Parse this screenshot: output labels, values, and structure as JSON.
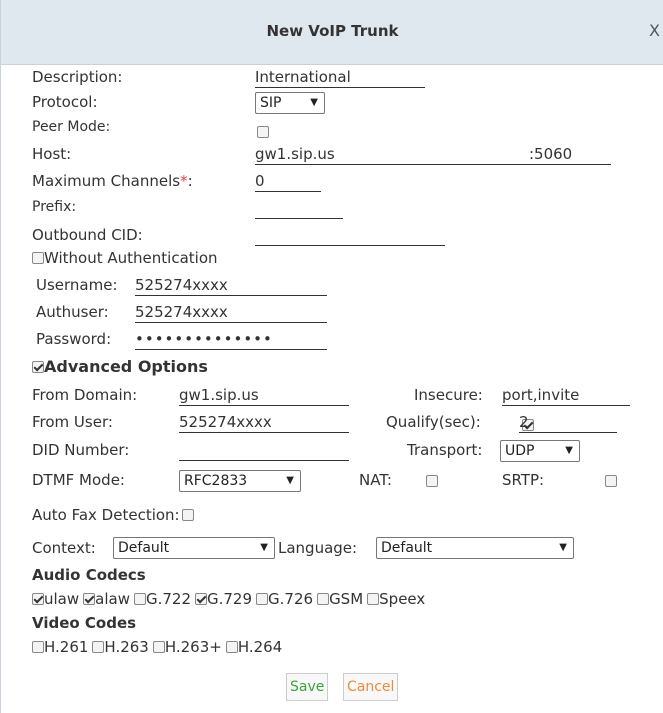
{
  "dialog": {
    "title": "New VoIP Trunk",
    "close": "X"
  },
  "form": {
    "description": {
      "label": "Description:",
      "value": "International"
    },
    "protocol": {
      "label": "Protocol:",
      "value": "SIP"
    },
    "peer_mode": {
      "label": "Peer Mode:",
      "checked": false
    },
    "host": {
      "label": "Host:",
      "value": "gw1.sip.us",
      "port": ":5060"
    },
    "max_channels": {
      "label": "Maximum Channels",
      "required": "*",
      "colon": ":",
      "value": "0"
    },
    "prefix": {
      "label": "Prefix:",
      "value": ""
    },
    "outbound_cid": {
      "label": "Outbound CID:",
      "value": ""
    },
    "without_auth": {
      "label": "Without Authentication",
      "checked": false
    },
    "username": {
      "label": "Username:",
      "value": "525274xxxx"
    },
    "authuser": {
      "label": "Authuser:",
      "value": "525274xxxx"
    },
    "password": {
      "label": "Password:",
      "value": "••••••••••••••"
    }
  },
  "advanced": {
    "label": "Advanced Options",
    "checked": true,
    "from_domain": {
      "label": "From Domain:",
      "value": "gw1.sip.us"
    },
    "insecure": {
      "label": "Insecure:",
      "value": "port,invite"
    },
    "from_user": {
      "label": "From User:",
      "value": "525274xxxx"
    },
    "qualify": {
      "label": "Qualify(sec):",
      "checked": true,
      "value": "2"
    },
    "did_number": {
      "label": "DID Number:",
      "value": ""
    },
    "transport": {
      "label": "Transport:",
      "value": "UDP"
    },
    "dtmf_mode": {
      "label": "DTMF Mode:",
      "value": "RFC2833"
    },
    "nat": {
      "label": "NAT:",
      "checked": false
    },
    "srtp": {
      "label": "SRTP:",
      "checked": false
    },
    "auto_fax": {
      "label": "Auto Fax Detection:",
      "checked": false
    },
    "context": {
      "label": "Context:",
      "value": "Default"
    },
    "language": {
      "label": "Language:",
      "value": "Default"
    }
  },
  "audio_codecs": {
    "heading": "Audio Codecs",
    "items": [
      {
        "label": "ulaw",
        "checked": true
      },
      {
        "label": "alaw",
        "checked": true
      },
      {
        "label": "G.722",
        "checked": false
      },
      {
        "label": "G.729",
        "checked": true
      },
      {
        "label": "G.726",
        "checked": false
      },
      {
        "label": "GSM",
        "checked": false
      },
      {
        "label": "Speex",
        "checked": false
      }
    ]
  },
  "video_codecs": {
    "heading": "Video Codes",
    "items": [
      {
        "label": "H.261",
        "checked": false
      },
      {
        "label": "H.263",
        "checked": false
      },
      {
        "label": "H.263+",
        "checked": false
      },
      {
        "label": "H.264",
        "checked": false
      }
    ]
  },
  "buttons": {
    "save": "Save",
    "cancel": "Cancel"
  },
  "colors": {
    "titlebar": "#dfe7ef",
    "save": "#3aa33a",
    "cancel": "#f08a3c",
    "required": "#e8413b"
  }
}
